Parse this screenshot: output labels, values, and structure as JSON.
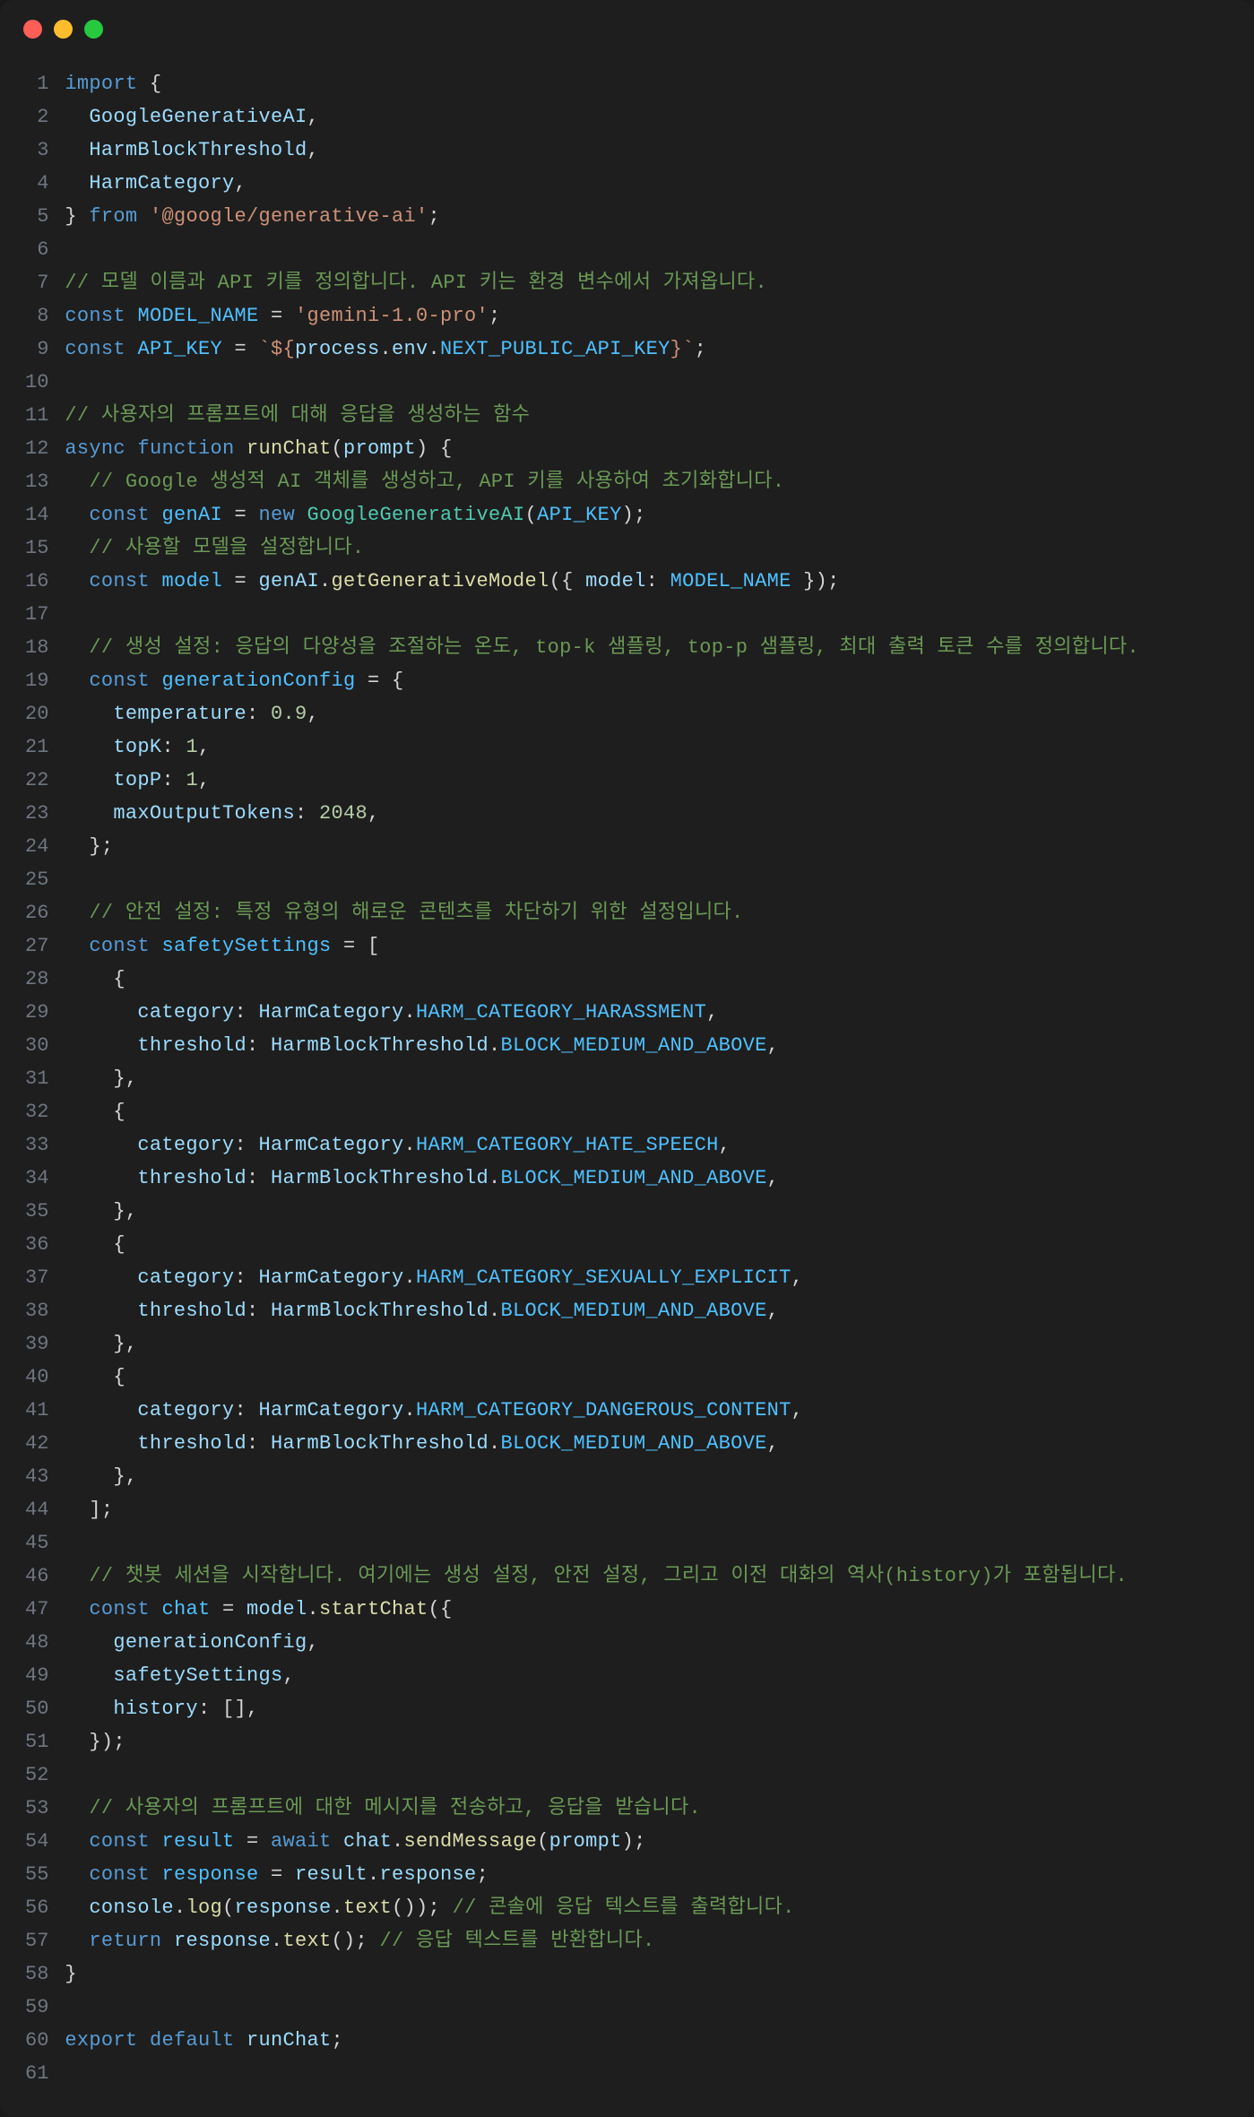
{
  "window": {
    "traffic_lights": [
      "red",
      "yellow",
      "green"
    ]
  },
  "editor": {
    "line_numbers": [
      "1",
      "2",
      "3",
      "4",
      "5",
      "6",
      "7",
      "8",
      "9",
      "10",
      "11",
      "12",
      "13",
      "14",
      "15",
      "16",
      "17",
      "18",
      "19",
      "20",
      "21",
      "22",
      "23",
      "24",
      "25",
      "26",
      "27",
      "28",
      "29",
      "30",
      "31",
      "32",
      "33",
      "34",
      "35",
      "36",
      "37",
      "38",
      "39",
      "40",
      "41",
      "42",
      "43",
      "44",
      "45",
      "46",
      "47",
      "48",
      "49",
      "50",
      "51",
      "52",
      "53",
      "54",
      "55",
      "56",
      "57",
      "58",
      "59",
      "60",
      "61"
    ],
    "lines": [
      [
        {
          "t": "import",
          "c": "kw"
        },
        {
          "t": " {",
          "c": "pun"
        }
      ],
      [
        {
          "t": "  ",
          "c": "pun"
        },
        {
          "t": "GoogleGenerativeAI",
          "c": "var"
        },
        {
          "t": ",",
          "c": "pun"
        }
      ],
      [
        {
          "t": "  ",
          "c": "pun"
        },
        {
          "t": "HarmBlockThreshold",
          "c": "var"
        },
        {
          "t": ",",
          "c": "pun"
        }
      ],
      [
        {
          "t": "  ",
          "c": "pun"
        },
        {
          "t": "HarmCategory",
          "c": "var"
        },
        {
          "t": ",",
          "c": "pun"
        }
      ],
      [
        {
          "t": "} ",
          "c": "pun"
        },
        {
          "t": "from",
          "c": "kw"
        },
        {
          "t": " ",
          "c": "pun"
        },
        {
          "t": "'@google/generative-ai'",
          "c": "str"
        },
        {
          "t": ";",
          "c": "pun"
        }
      ],
      [],
      [
        {
          "t": "// 모델 이름과 API 키를 정의합니다. API 키는 환경 변수에서 가져옵니다.",
          "c": "com"
        }
      ],
      [
        {
          "t": "const",
          "c": "kw"
        },
        {
          "t": " ",
          "c": "pun"
        },
        {
          "t": "MODEL_NAME",
          "c": "const"
        },
        {
          "t": " = ",
          "c": "op"
        },
        {
          "t": "'gemini-1.0-pro'",
          "c": "str"
        },
        {
          "t": ";",
          "c": "pun"
        }
      ],
      [
        {
          "t": "const",
          "c": "kw"
        },
        {
          "t": " ",
          "c": "pun"
        },
        {
          "t": "API_KEY",
          "c": "const"
        },
        {
          "t": " = ",
          "c": "op"
        },
        {
          "t": "`${",
          "c": "str"
        },
        {
          "t": "process",
          "c": "var"
        },
        {
          "t": ".",
          "c": "pun"
        },
        {
          "t": "env",
          "c": "var"
        },
        {
          "t": ".",
          "c": "pun"
        },
        {
          "t": "NEXT_PUBLIC_API_KEY",
          "c": "const"
        },
        {
          "t": "}`",
          "c": "str"
        },
        {
          "t": ";",
          "c": "pun"
        }
      ],
      [],
      [
        {
          "t": "// 사용자의 프롬프트에 대해 응답을 생성하는 함수",
          "c": "com"
        }
      ],
      [
        {
          "t": "async",
          "c": "kw"
        },
        {
          "t": " ",
          "c": "pun"
        },
        {
          "t": "function",
          "c": "kw"
        },
        {
          "t": " ",
          "c": "pun"
        },
        {
          "t": "runChat",
          "c": "fn"
        },
        {
          "t": "(",
          "c": "pun"
        },
        {
          "t": "prompt",
          "c": "var"
        },
        {
          "t": ") {",
          "c": "pun"
        }
      ],
      [
        {
          "t": "  ",
          "c": "pun"
        },
        {
          "t": "// Google 생성적 AI 객체를 생성하고, API 키를 사용하여 초기화합니다.",
          "c": "com"
        }
      ],
      [
        {
          "t": "  ",
          "c": "pun"
        },
        {
          "t": "const",
          "c": "kw"
        },
        {
          "t": " ",
          "c": "pun"
        },
        {
          "t": "genAI",
          "c": "const"
        },
        {
          "t": " = ",
          "c": "op"
        },
        {
          "t": "new",
          "c": "kw"
        },
        {
          "t": " ",
          "c": "pun"
        },
        {
          "t": "GoogleGenerativeAI",
          "c": "typ"
        },
        {
          "t": "(",
          "c": "pun"
        },
        {
          "t": "API_KEY",
          "c": "const"
        },
        {
          "t": ");",
          "c": "pun"
        }
      ],
      [
        {
          "t": "  ",
          "c": "pun"
        },
        {
          "t": "// 사용할 모델을 설정합니다.",
          "c": "com"
        }
      ],
      [
        {
          "t": "  ",
          "c": "pun"
        },
        {
          "t": "const",
          "c": "kw"
        },
        {
          "t": " ",
          "c": "pun"
        },
        {
          "t": "model",
          "c": "const"
        },
        {
          "t": " = ",
          "c": "op"
        },
        {
          "t": "genAI",
          "c": "var"
        },
        {
          "t": ".",
          "c": "pun"
        },
        {
          "t": "getGenerativeModel",
          "c": "fn"
        },
        {
          "t": "({ ",
          "c": "pun"
        },
        {
          "t": "model",
          "c": "prop"
        },
        {
          "t": ": ",
          "c": "pun"
        },
        {
          "t": "MODEL_NAME",
          "c": "const"
        },
        {
          "t": " });",
          "c": "pun"
        }
      ],
      [],
      [
        {
          "t": "  ",
          "c": "pun"
        },
        {
          "t": "// 생성 설정: 응답의 다양성을 조절하는 온도, top-k 샘플링, top-p 샘플링, 최대 출력 토큰 수를 정의합니다.",
          "c": "com"
        }
      ],
      [
        {
          "t": "  ",
          "c": "pun"
        },
        {
          "t": "const",
          "c": "kw"
        },
        {
          "t": " ",
          "c": "pun"
        },
        {
          "t": "generationConfig",
          "c": "const"
        },
        {
          "t": " = {",
          "c": "op"
        }
      ],
      [
        {
          "t": "    ",
          "c": "pun"
        },
        {
          "t": "temperature",
          "c": "prop"
        },
        {
          "t": ": ",
          "c": "pun"
        },
        {
          "t": "0.9",
          "c": "num"
        },
        {
          "t": ",",
          "c": "pun"
        }
      ],
      [
        {
          "t": "    ",
          "c": "pun"
        },
        {
          "t": "topK",
          "c": "prop"
        },
        {
          "t": ": ",
          "c": "pun"
        },
        {
          "t": "1",
          "c": "num"
        },
        {
          "t": ",",
          "c": "pun"
        }
      ],
      [
        {
          "t": "    ",
          "c": "pun"
        },
        {
          "t": "topP",
          "c": "prop"
        },
        {
          "t": ": ",
          "c": "pun"
        },
        {
          "t": "1",
          "c": "num"
        },
        {
          "t": ",",
          "c": "pun"
        }
      ],
      [
        {
          "t": "    ",
          "c": "pun"
        },
        {
          "t": "maxOutputTokens",
          "c": "prop"
        },
        {
          "t": ": ",
          "c": "pun"
        },
        {
          "t": "2048",
          "c": "num"
        },
        {
          "t": ",",
          "c": "pun"
        }
      ],
      [
        {
          "t": "  };",
          "c": "pun"
        }
      ],
      [],
      [
        {
          "t": "  ",
          "c": "pun"
        },
        {
          "t": "// 안전 설정: 특정 유형의 해로운 콘텐츠를 차단하기 위한 설정입니다.",
          "c": "com"
        }
      ],
      [
        {
          "t": "  ",
          "c": "pun"
        },
        {
          "t": "const",
          "c": "kw"
        },
        {
          "t": " ",
          "c": "pun"
        },
        {
          "t": "safetySettings",
          "c": "const"
        },
        {
          "t": " = [",
          "c": "op"
        }
      ],
      [
        {
          "t": "    {",
          "c": "pun"
        }
      ],
      [
        {
          "t": "      ",
          "c": "pun"
        },
        {
          "t": "category",
          "c": "prop"
        },
        {
          "t": ": ",
          "c": "pun"
        },
        {
          "t": "HarmCategory",
          "c": "var"
        },
        {
          "t": ".",
          "c": "pun"
        },
        {
          "t": "HARM_CATEGORY_HARASSMENT",
          "c": "const"
        },
        {
          "t": ",",
          "c": "pun"
        }
      ],
      [
        {
          "t": "      ",
          "c": "pun"
        },
        {
          "t": "threshold",
          "c": "prop"
        },
        {
          "t": ": ",
          "c": "pun"
        },
        {
          "t": "HarmBlockThreshold",
          "c": "var"
        },
        {
          "t": ".",
          "c": "pun"
        },
        {
          "t": "BLOCK_MEDIUM_AND_ABOVE",
          "c": "const"
        },
        {
          "t": ",",
          "c": "pun"
        }
      ],
      [
        {
          "t": "    },",
          "c": "pun"
        }
      ],
      [
        {
          "t": "    {",
          "c": "pun"
        }
      ],
      [
        {
          "t": "      ",
          "c": "pun"
        },
        {
          "t": "category",
          "c": "prop"
        },
        {
          "t": ": ",
          "c": "pun"
        },
        {
          "t": "HarmCategory",
          "c": "var"
        },
        {
          "t": ".",
          "c": "pun"
        },
        {
          "t": "HARM_CATEGORY_HATE_SPEECH",
          "c": "const"
        },
        {
          "t": ",",
          "c": "pun"
        }
      ],
      [
        {
          "t": "      ",
          "c": "pun"
        },
        {
          "t": "threshold",
          "c": "prop"
        },
        {
          "t": ": ",
          "c": "pun"
        },
        {
          "t": "HarmBlockThreshold",
          "c": "var"
        },
        {
          "t": ".",
          "c": "pun"
        },
        {
          "t": "BLOCK_MEDIUM_AND_ABOVE",
          "c": "const"
        },
        {
          "t": ",",
          "c": "pun"
        }
      ],
      [
        {
          "t": "    },",
          "c": "pun"
        }
      ],
      [
        {
          "t": "    {",
          "c": "pun"
        }
      ],
      [
        {
          "t": "      ",
          "c": "pun"
        },
        {
          "t": "category",
          "c": "prop"
        },
        {
          "t": ": ",
          "c": "pun"
        },
        {
          "t": "HarmCategory",
          "c": "var"
        },
        {
          "t": ".",
          "c": "pun"
        },
        {
          "t": "HARM_CATEGORY_SEXUALLY_EXPLICIT",
          "c": "const"
        },
        {
          "t": ",",
          "c": "pun"
        }
      ],
      [
        {
          "t": "      ",
          "c": "pun"
        },
        {
          "t": "threshold",
          "c": "prop"
        },
        {
          "t": ": ",
          "c": "pun"
        },
        {
          "t": "HarmBlockThreshold",
          "c": "var"
        },
        {
          "t": ".",
          "c": "pun"
        },
        {
          "t": "BLOCK_MEDIUM_AND_ABOVE",
          "c": "const"
        },
        {
          "t": ",",
          "c": "pun"
        }
      ],
      [
        {
          "t": "    },",
          "c": "pun"
        }
      ],
      [
        {
          "t": "    {",
          "c": "pun"
        }
      ],
      [
        {
          "t": "      ",
          "c": "pun"
        },
        {
          "t": "category",
          "c": "prop"
        },
        {
          "t": ": ",
          "c": "pun"
        },
        {
          "t": "HarmCategory",
          "c": "var"
        },
        {
          "t": ".",
          "c": "pun"
        },
        {
          "t": "HARM_CATEGORY_DANGEROUS_CONTENT",
          "c": "const"
        },
        {
          "t": ",",
          "c": "pun"
        }
      ],
      [
        {
          "t": "      ",
          "c": "pun"
        },
        {
          "t": "threshold",
          "c": "prop"
        },
        {
          "t": ": ",
          "c": "pun"
        },
        {
          "t": "HarmBlockThreshold",
          "c": "var"
        },
        {
          "t": ".",
          "c": "pun"
        },
        {
          "t": "BLOCK_MEDIUM_AND_ABOVE",
          "c": "const"
        },
        {
          "t": ",",
          "c": "pun"
        }
      ],
      [
        {
          "t": "    },",
          "c": "pun"
        }
      ],
      [
        {
          "t": "  ];",
          "c": "pun"
        }
      ],
      [],
      [
        {
          "t": "  ",
          "c": "pun"
        },
        {
          "t": "// 챗봇 세션을 시작합니다. 여기에는 생성 설정, 안전 설정, 그리고 이전 대화의 역사(history)가 포함됩니다.",
          "c": "com"
        }
      ],
      [
        {
          "t": "  ",
          "c": "pun"
        },
        {
          "t": "const",
          "c": "kw"
        },
        {
          "t": " ",
          "c": "pun"
        },
        {
          "t": "chat",
          "c": "const"
        },
        {
          "t": " = ",
          "c": "op"
        },
        {
          "t": "model",
          "c": "var"
        },
        {
          "t": ".",
          "c": "pun"
        },
        {
          "t": "startChat",
          "c": "fn"
        },
        {
          "t": "({",
          "c": "pun"
        }
      ],
      [
        {
          "t": "    ",
          "c": "pun"
        },
        {
          "t": "generationConfig",
          "c": "var"
        },
        {
          "t": ",",
          "c": "pun"
        }
      ],
      [
        {
          "t": "    ",
          "c": "pun"
        },
        {
          "t": "safetySettings",
          "c": "var"
        },
        {
          "t": ",",
          "c": "pun"
        }
      ],
      [
        {
          "t": "    ",
          "c": "pun"
        },
        {
          "t": "history",
          "c": "prop"
        },
        {
          "t": ": [],",
          "c": "pun"
        }
      ],
      [
        {
          "t": "  });",
          "c": "pun"
        }
      ],
      [],
      [
        {
          "t": "  ",
          "c": "pun"
        },
        {
          "t": "// 사용자의 프롬프트에 대한 메시지를 전송하고, 응답을 받습니다.",
          "c": "com"
        }
      ],
      [
        {
          "t": "  ",
          "c": "pun"
        },
        {
          "t": "const",
          "c": "kw"
        },
        {
          "t": " ",
          "c": "pun"
        },
        {
          "t": "result",
          "c": "const"
        },
        {
          "t": " = ",
          "c": "op"
        },
        {
          "t": "await",
          "c": "kw"
        },
        {
          "t": " ",
          "c": "pun"
        },
        {
          "t": "chat",
          "c": "var"
        },
        {
          "t": ".",
          "c": "pun"
        },
        {
          "t": "sendMessage",
          "c": "fn"
        },
        {
          "t": "(",
          "c": "pun"
        },
        {
          "t": "prompt",
          "c": "var"
        },
        {
          "t": ");",
          "c": "pun"
        }
      ],
      [
        {
          "t": "  ",
          "c": "pun"
        },
        {
          "t": "const",
          "c": "kw"
        },
        {
          "t": " ",
          "c": "pun"
        },
        {
          "t": "response",
          "c": "const"
        },
        {
          "t": " = ",
          "c": "op"
        },
        {
          "t": "result",
          "c": "var"
        },
        {
          "t": ".",
          "c": "pun"
        },
        {
          "t": "response",
          "c": "var"
        },
        {
          "t": ";",
          "c": "pun"
        }
      ],
      [
        {
          "t": "  ",
          "c": "pun"
        },
        {
          "t": "console",
          "c": "var"
        },
        {
          "t": ".",
          "c": "pun"
        },
        {
          "t": "log",
          "c": "fn"
        },
        {
          "t": "(",
          "c": "pun"
        },
        {
          "t": "response",
          "c": "var"
        },
        {
          "t": ".",
          "c": "pun"
        },
        {
          "t": "text",
          "c": "fn"
        },
        {
          "t": "()); ",
          "c": "pun"
        },
        {
          "t": "// 콘솔에 응답 텍스트를 출력합니다.",
          "c": "com"
        }
      ],
      [
        {
          "t": "  ",
          "c": "pun"
        },
        {
          "t": "return",
          "c": "kw"
        },
        {
          "t": " ",
          "c": "pun"
        },
        {
          "t": "response",
          "c": "var"
        },
        {
          "t": ".",
          "c": "pun"
        },
        {
          "t": "text",
          "c": "fn"
        },
        {
          "t": "(); ",
          "c": "pun"
        },
        {
          "t": "// 응답 텍스트를 반환합니다.",
          "c": "com"
        }
      ],
      [
        {
          "t": "}",
          "c": "pun"
        }
      ],
      [],
      [
        {
          "t": "export",
          "c": "kw"
        },
        {
          "t": " ",
          "c": "pun"
        },
        {
          "t": "default",
          "c": "kw"
        },
        {
          "t": " ",
          "c": "pun"
        },
        {
          "t": "runChat",
          "c": "var"
        },
        {
          "t": ";",
          "c": "pun"
        }
      ],
      []
    ]
  }
}
